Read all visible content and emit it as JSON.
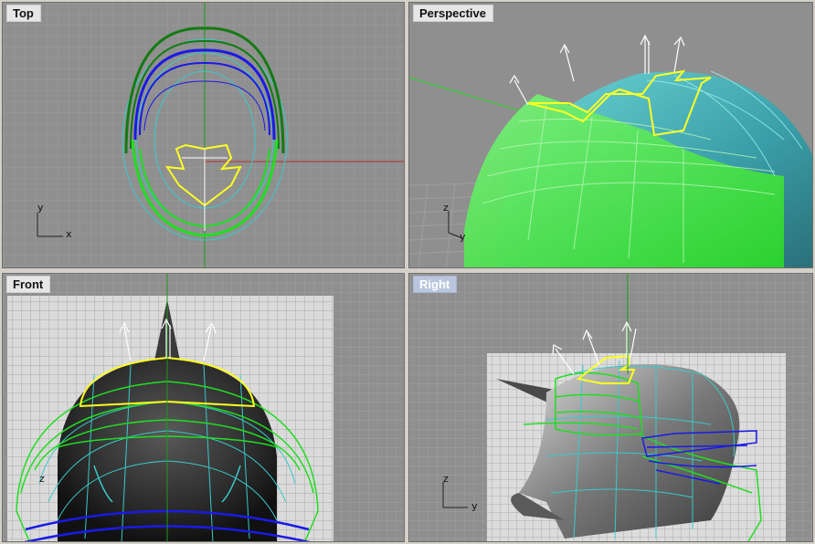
{
  "viewports": {
    "top": {
      "title": "Top",
      "axis_x": "x",
      "axis_y": "y"
    },
    "perspective": {
      "title": "Perspective",
      "axis_y": "y",
      "axis_z": "z"
    },
    "front": {
      "title": "Front",
      "axis_z": "z"
    },
    "right": {
      "title": "Right",
      "axis_y": "y",
      "axis_z": "z"
    }
  },
  "active_viewport": "Right",
  "colors": {
    "background": "#8f8f8f",
    "grid": "#9c9c9c",
    "curve_green": "#22dd22",
    "curve_blue": "#1a1ae6",
    "curve_cyan": "#3cc8c8",
    "curve_yellow": "#ffff22",
    "axis_green": "#1a9c1a",
    "axis_red": "#b03030"
  }
}
